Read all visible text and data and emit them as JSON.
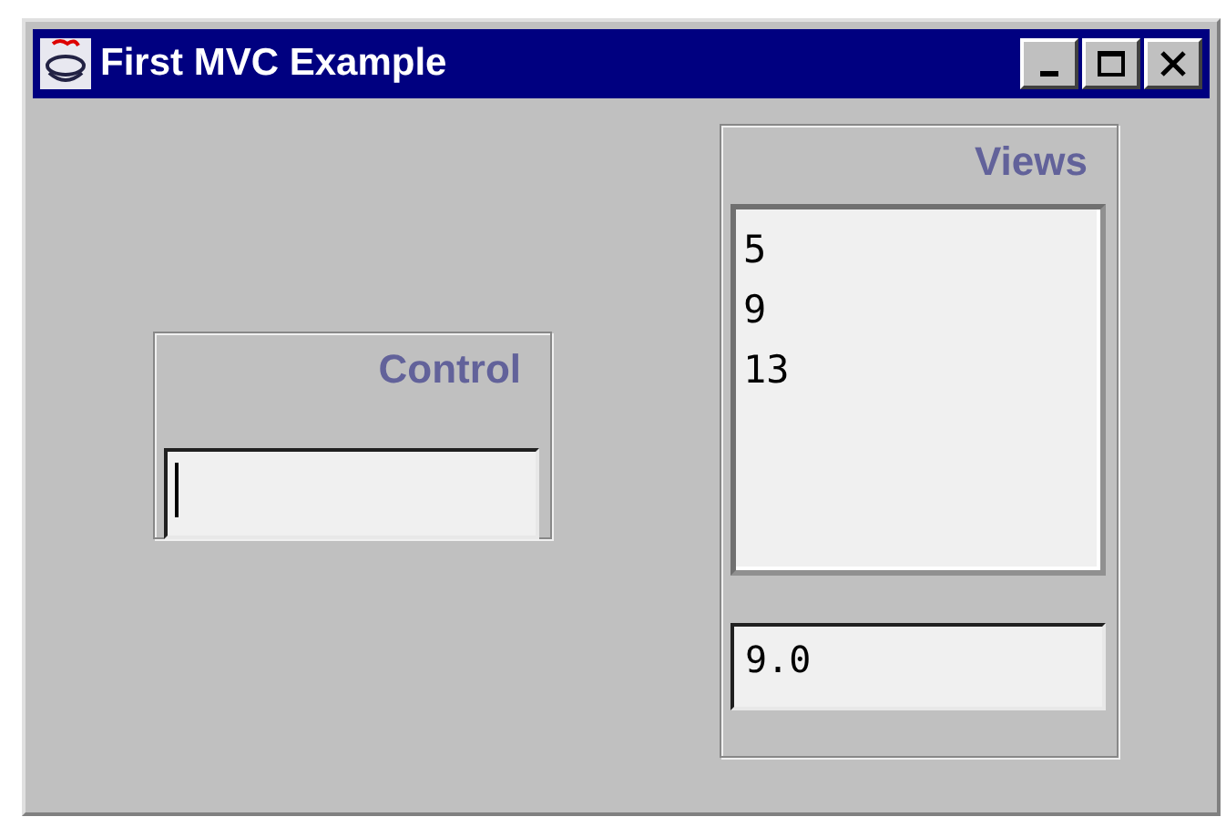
{
  "window": {
    "title": "First MVC Example"
  },
  "control": {
    "title": "Control"
  },
  "views": {
    "title": "Views",
    "list_items": [
      "5",
      "9",
      "13"
    ],
    "field_value": "9.0"
  }
}
